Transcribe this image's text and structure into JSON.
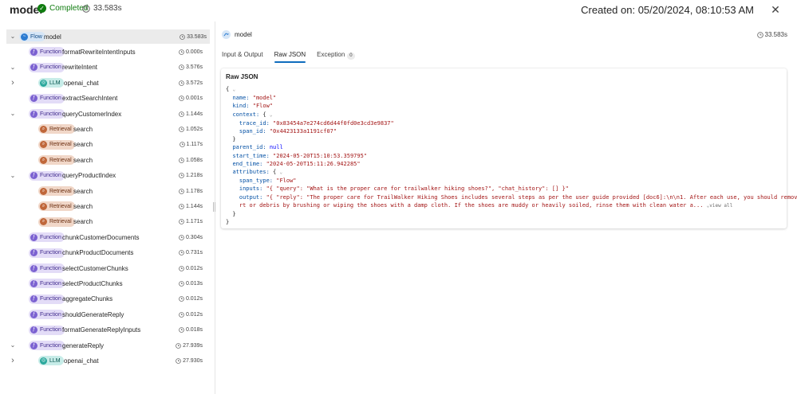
{
  "header": {
    "title": "model",
    "status": "Completed",
    "duration": "33.583s",
    "created": "Created on: 05/20/2024, 08:10:53 AM"
  },
  "colors": {
    "success": "#107c10",
    "accent": "#0f6cbd",
    "function_badge": "#e3dcf7",
    "llm_badge": "#c7ece8",
    "retrieval_badge": "#f1d7c8",
    "flow_badge": "#d6e6f7"
  },
  "tree": [
    {
      "kind": "Flow",
      "name": "model",
      "duration": "33.583s",
      "level": 0,
      "chevron": "down",
      "selected": true
    },
    {
      "kind": "Function",
      "name": "formatRewriteIntentInputs",
      "duration": "0.000s",
      "level": 1,
      "chevron": ""
    },
    {
      "kind": "Function",
      "name": "rewriteIntent",
      "duration": "3.576s",
      "level": 1,
      "chevron": "down"
    },
    {
      "kind": "LLM",
      "name": "openai_chat",
      "duration": "3.572s",
      "level": 2,
      "chevron": "right"
    },
    {
      "kind": "Function",
      "name": "extractSearchIntent",
      "duration": "0.001s",
      "level": 1,
      "chevron": ""
    },
    {
      "kind": "Function",
      "name": "queryCustomerIndex",
      "duration": "1.144s",
      "level": 1,
      "chevron": "down"
    },
    {
      "kind": "Retrieval",
      "name": "search",
      "duration": "1.052s",
      "level": 2,
      "chevron": ""
    },
    {
      "kind": "Retrieval",
      "name": "search",
      "duration": "1.117s",
      "level": 2,
      "chevron": ""
    },
    {
      "kind": "Retrieval",
      "name": "search",
      "duration": "1.058s",
      "level": 2,
      "chevron": ""
    },
    {
      "kind": "Function",
      "name": "queryProductIndex",
      "duration": "1.218s",
      "level": 1,
      "chevron": "down"
    },
    {
      "kind": "Retrieval",
      "name": "search",
      "duration": "1.178s",
      "level": 2,
      "chevron": ""
    },
    {
      "kind": "Retrieval",
      "name": "search",
      "duration": "1.144s",
      "level": 2,
      "chevron": ""
    },
    {
      "kind": "Retrieval",
      "name": "search",
      "duration": "1.171s",
      "level": 2,
      "chevron": ""
    },
    {
      "kind": "Function",
      "name": "chunkCustomerDocuments",
      "duration": "0.304s",
      "level": 1,
      "chevron": ""
    },
    {
      "kind": "Function",
      "name": "chunkProductDocuments",
      "duration": "0.731s",
      "level": 1,
      "chevron": ""
    },
    {
      "kind": "Function",
      "name": "selectCustomerChunks",
      "duration": "0.012s",
      "level": 1,
      "chevron": ""
    },
    {
      "kind": "Function",
      "name": "selectProductChunks",
      "duration": "0.013s",
      "level": 1,
      "chevron": ""
    },
    {
      "kind": "Function",
      "name": "aggregateChunks",
      "duration": "0.012s",
      "level": 1,
      "chevron": ""
    },
    {
      "kind": "Function",
      "name": "shouldGenerateReply",
      "duration": "0.012s",
      "level": 1,
      "chevron": ""
    },
    {
      "kind": "Function",
      "name": "formatGenerateReplyInputs",
      "duration": "0.018s",
      "level": 1,
      "chevron": ""
    },
    {
      "kind": "Function",
      "name": "generateReply",
      "duration": "27.939s",
      "level": 1,
      "chevron": "down"
    },
    {
      "kind": "LLM",
      "name": "openai_chat",
      "duration": "27.930s",
      "level": 2,
      "chevron": "right"
    }
  ],
  "detail": {
    "name": "model",
    "duration": "33.583s",
    "tabs": [
      {
        "label": "Input & Output",
        "active": false
      },
      {
        "label": "Raw JSON",
        "active": true
      },
      {
        "label": "Exception",
        "active": false,
        "count": "0"
      }
    ],
    "card_title": "Raw JSON",
    "view_all": "view all",
    "json": {
      "name": "\"model\"",
      "kind": "\"Flow\"",
      "trace_id": "\"0x83454a7e274cd6d44f0fd0e3cd3e9837\"",
      "span_id": "\"0x4423133a1191cf07\"",
      "parent_id": "null",
      "start_time": "\"2024-05-20T15:10:53.359795\"",
      "end_time": "\"2024-05-20T15:11:26.942285\"",
      "span_type": "\"Flow\"",
      "inputs": "\"{ \"query\": \"What is the proper care for trailwalker hiking shoes?\", \"chat_history\": [] }\"",
      "output_line1": "\"{ \"reply\": \"The proper care for TrailWalker Hiking Shoes includes several steps as per the user guide provided [doc6]:\\n\\n1. After each use, you should remove any di",
      "output_line2": "rt or debris by brushing or wiping the shoes with a damp cloth. If the shoes are muddy or heavily soiled, rinse them with clean water a..."
    }
  }
}
